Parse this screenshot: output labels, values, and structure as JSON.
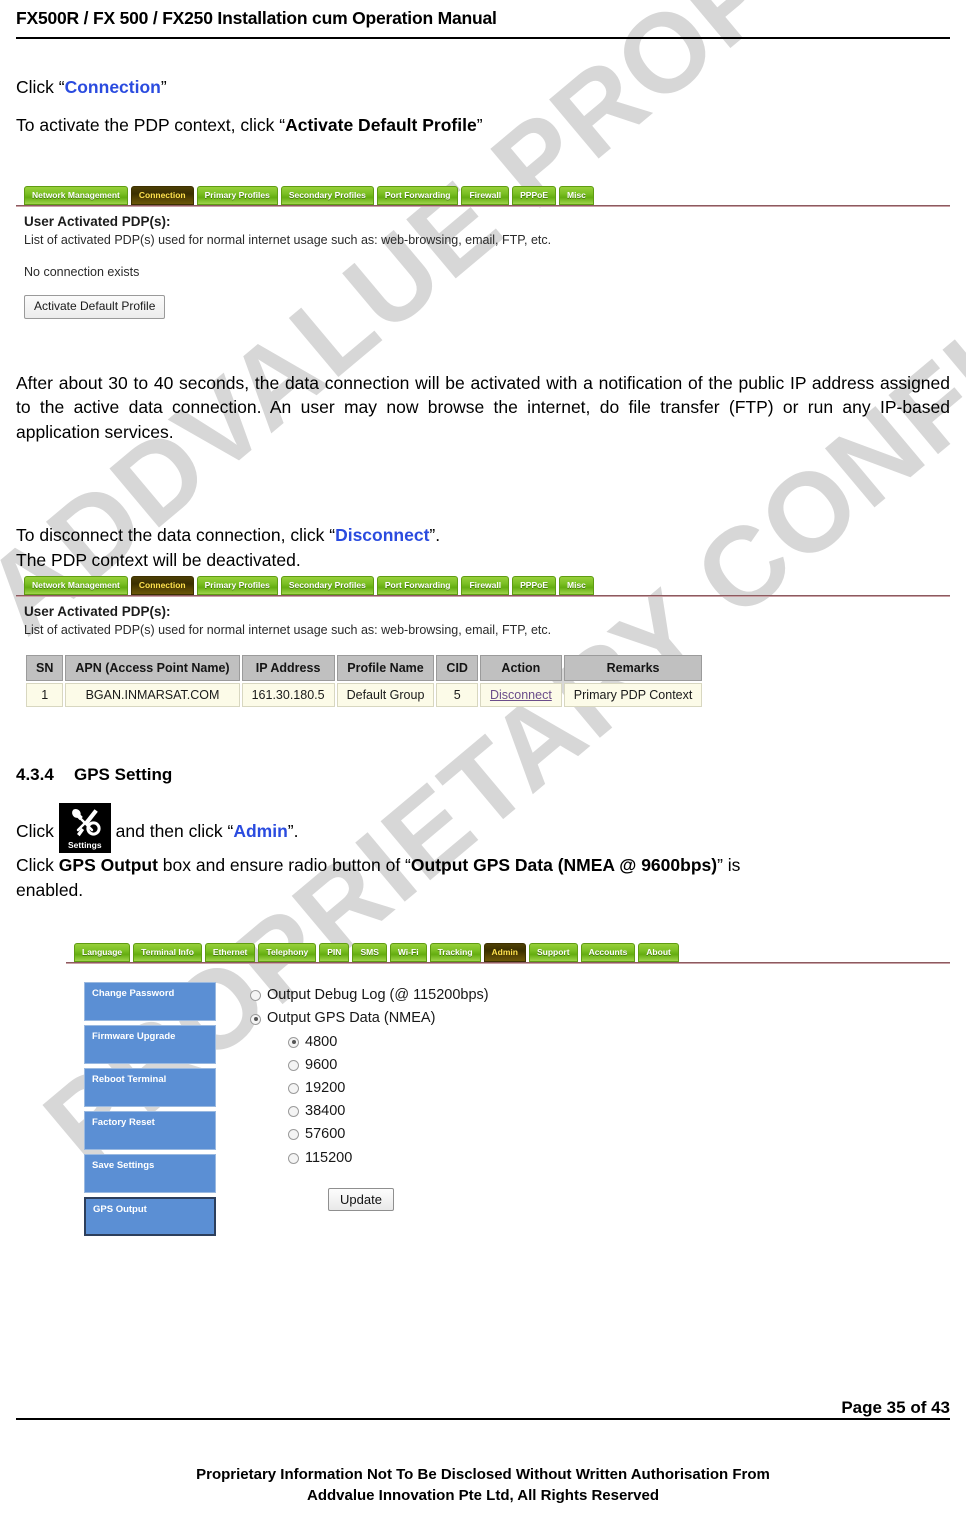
{
  "document": {
    "header_title": "FX500R / FX 500 / FX250 Installation cum Operation Manual",
    "page_number": "Page 35 of 43",
    "footer_line1": "Proprietary Information Not To Be Disclosed Without Written Authorisation From",
    "footer_line2": "Addvalue Innovation Pte Ltd, All Rights Reserved",
    "watermark_line1": "ADDVALUE PROPRIETARY",
    "watermark_line2": "PROPRIETARY CONFIDENTIAL",
    "link_color": "#2a4bdf"
  },
  "intro": {
    "click_prefix": "Click “",
    "connection_link": "Connection",
    "click_suffix": "”",
    "activate_prefix": "To activate the PDP context, click “",
    "activate_bold": "Activate Default Profile",
    "activate_suffix": "”"
  },
  "screenshot1": {
    "tabs": [
      {
        "label": "Network Management",
        "active": false
      },
      {
        "label": "Connection",
        "active": true
      },
      {
        "label": "Primary Profiles",
        "active": false
      },
      {
        "label": "Secondary Profiles",
        "active": false
      },
      {
        "label": "Port Forwarding",
        "active": false
      },
      {
        "label": "Firewall",
        "active": false
      },
      {
        "label": "PPPoE",
        "active": false
      },
      {
        "label": "Misc",
        "active": false
      }
    ],
    "heading": "User Activated PDP(s):",
    "subtitle": "List of activated PDP(s) used for normal internet usage such as: web-browsing, email, FTP, etc.",
    "status": "No connection exists",
    "button_label": "Activate Default Profile"
  },
  "paragraph1": "After about 30 to 40 seconds, the data connection will be activated with a notification of the public IP address assigned to the active data connection. An user may now browse the internet, do file transfer (FTP) or run any IP-based application services.",
  "disconnect": {
    "line1_prefix": "To disconnect the data connection, click “",
    "line1_link": "Disconnect",
    "line1_suffix": "”.",
    "line2": "The PDP context will be deactivated."
  },
  "screenshot2": {
    "tabs": [
      {
        "label": "Network Management",
        "active": false
      },
      {
        "label": "Connection",
        "active": true
      },
      {
        "label": "Primary Profiles",
        "active": false
      },
      {
        "label": "Secondary Profiles",
        "active": false
      },
      {
        "label": "Port Forwarding",
        "active": false
      },
      {
        "label": "Firewall",
        "active": false
      },
      {
        "label": "PPPoE",
        "active": false
      },
      {
        "label": "Misc",
        "active": false
      }
    ],
    "heading": "User Activated PDP(s):",
    "subtitle": "List of activated PDP(s) used for normal internet usage such as: web-browsing, email, FTP, etc.",
    "table": {
      "columns": [
        "SN",
        "APN (Access Point Name)",
        "IP Address",
        "Profile Name",
        "CID",
        "Action",
        "Remarks"
      ],
      "rows": [
        {
          "sn": "1",
          "apn": "BGAN.INMARSAT.COM",
          "ip": "161.30.180.5",
          "profile": "Default Group",
          "cid": "5",
          "action": "Disconnect",
          "remarks": "Primary PDP Context"
        }
      ]
    }
  },
  "gps_section": {
    "number": "4.3.4",
    "title": "GPS Setting",
    "icon_label": "Settings",
    "line1_prefix": "Click ",
    "line1_mid": " and then click “",
    "line1_link": "Admin",
    "line1_suffix": "”.",
    "line2_prefix": "Click ",
    "line2_bold1": "GPS Output",
    "line2_mid": " box and ensure radio button of “",
    "line2_bold2": "Output GPS Data (NMEA @ 9600bps)",
    "line2_suffix": "” is",
    "line3": "enabled."
  },
  "screenshot3": {
    "tabs": [
      {
        "label": "Language",
        "active": false
      },
      {
        "label": "Terminal Info",
        "active": false
      },
      {
        "label": "Ethernet",
        "active": false
      },
      {
        "label": "Telephony",
        "active": false
      },
      {
        "label": "PIN",
        "active": false
      },
      {
        "label": "SMS",
        "active": false
      },
      {
        "label": "Wi-Fi",
        "active": false
      },
      {
        "label": "Tracking",
        "active": false
      },
      {
        "label": "Admin",
        "active": true
      },
      {
        "label": "Support",
        "active": false
      },
      {
        "label": "Accounts",
        "active": false
      },
      {
        "label": "About",
        "active": false
      }
    ],
    "side_buttons": [
      {
        "label": "Change Password",
        "selected": false
      },
      {
        "label": "Firmware Upgrade",
        "selected": false
      },
      {
        "label": "Reboot Terminal",
        "selected": false
      },
      {
        "label": "Factory Reset",
        "selected": false
      },
      {
        "label": "Save Settings",
        "selected": false
      },
      {
        "label": "GPS Output",
        "selected": true
      }
    ],
    "output_options": [
      {
        "label": "Output Debug Log (@ 115200bps)",
        "selected": false
      },
      {
        "label": "Output GPS Data (NMEA)",
        "selected": true
      }
    ],
    "baud_options": [
      {
        "label": "4800",
        "selected": true
      },
      {
        "label": "9600",
        "selected": false
      },
      {
        "label": "19200",
        "selected": false
      },
      {
        "label": "38400",
        "selected": false
      },
      {
        "label": "57600",
        "selected": false
      },
      {
        "label": "115200",
        "selected": false
      }
    ],
    "update_label": "Update"
  }
}
